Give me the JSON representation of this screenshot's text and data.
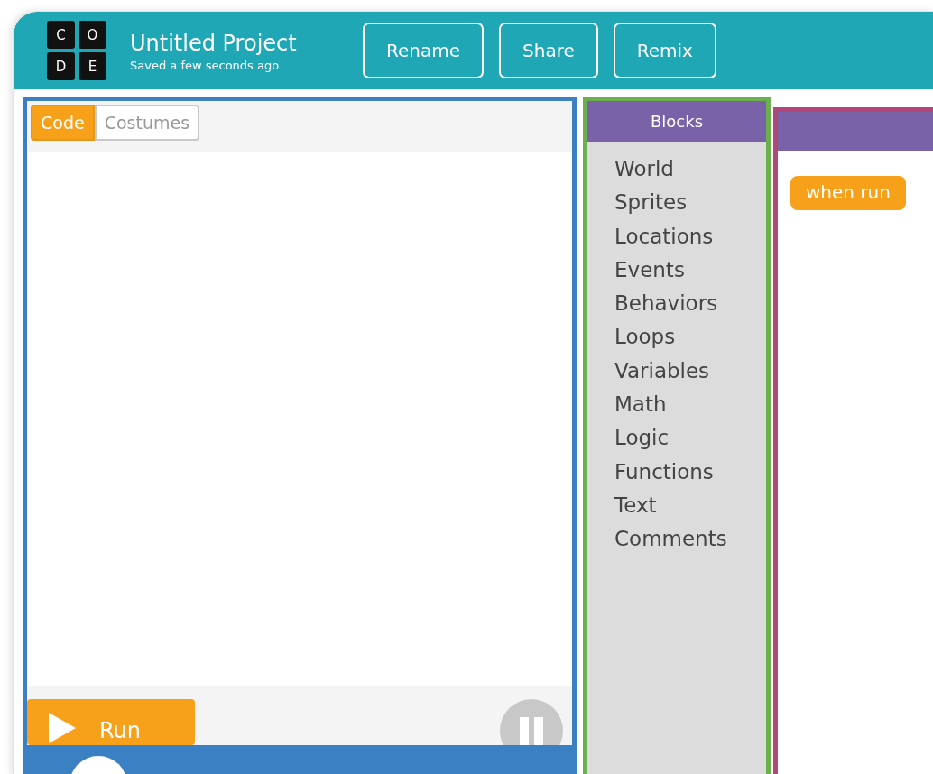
{
  "header": {
    "logo_letters": [
      "C",
      "O",
      "D",
      "E"
    ],
    "title": "Untitled Project",
    "subtitle": "Saved a few seconds ago",
    "buttons": [
      "Rename",
      "Share",
      "Remix"
    ]
  },
  "code_panel": {
    "tabs": [
      {
        "label": "Code",
        "selected": true
      },
      {
        "label": "Costumes",
        "selected": false
      }
    ],
    "run_button": "Run"
  },
  "toolbox": {
    "title": "Blocks",
    "categories": [
      "World",
      "Sprites",
      "Locations",
      "Events",
      "Behaviors",
      "Loops",
      "Variables",
      "Math",
      "Logic",
      "Functions",
      "Text",
      "Comments"
    ]
  },
  "workspace": {
    "blocks": [
      "when run"
    ]
  }
}
